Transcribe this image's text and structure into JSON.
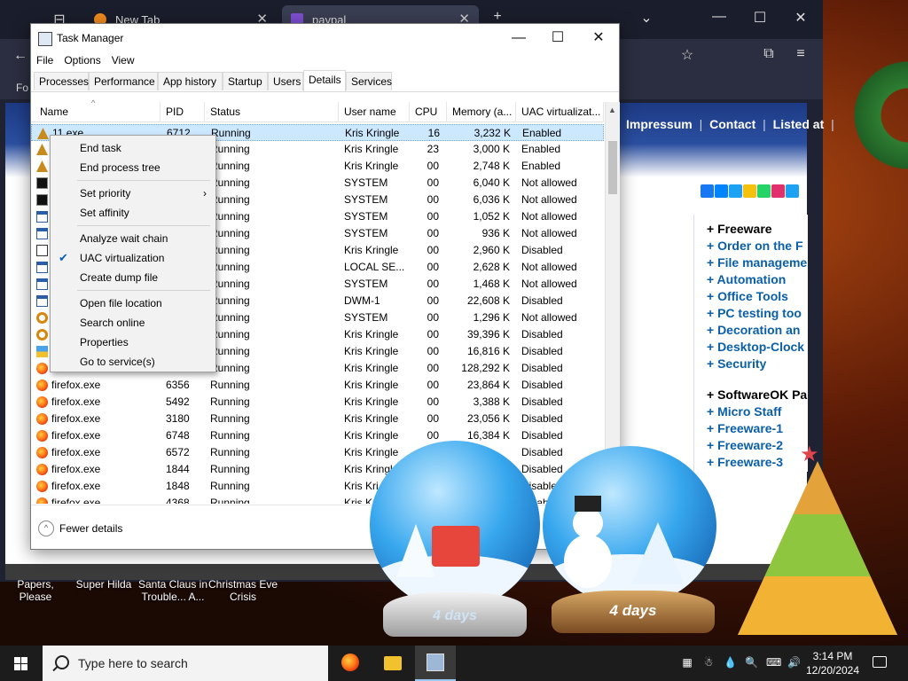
{
  "browser": {
    "tabs": [
      {
        "label": "New Tab",
        "close": "✕"
      },
      {
        "label": "paypal",
        "close": "✕"
      }
    ],
    "new_tab": "+",
    "list_tabs": "⌄",
    "win_min": "—",
    "win_max": "☐",
    "win_close": "✕",
    "bookmarks_start": "Fo",
    "site_nav": [
      "Impressum",
      "Contact",
      "Listed at"
    ],
    "site_nav_sep": "|",
    "sidebar_items": [
      {
        "label": "+ Freeware",
        "style": "black"
      },
      {
        "label": "+ Order on the F",
        "style": "blue"
      },
      {
        "label": "+ File manageme",
        "style": "blue"
      },
      {
        "label": "+ Automation",
        "style": "blue"
      },
      {
        "label": "+ Office Tools",
        "style": "blue"
      },
      {
        "label": "+ PC testing too",
        "style": "blue"
      },
      {
        "label": "+ Decoration an",
        "style": "blue"
      },
      {
        "label": "+ Desktop-Clock",
        "style": "blue"
      },
      {
        "label": "+ Security",
        "style": "blue"
      },
      {
        "label": "+ SoftwareOK Pa",
        "style": "black"
      },
      {
        "label": "+ Micro Staff",
        "style": "blue"
      },
      {
        "label": "+ Freeware-1",
        "style": "blue"
      },
      {
        "label": "+ Freeware-2",
        "style": "blue"
      },
      {
        "label": "+ Freeware-3",
        "style": "blue"
      }
    ],
    "social_colors": [
      "#1877f2",
      "#0084ff",
      "#1da1f2",
      "#f4c20d",
      "#25d366",
      "#e1306c",
      "#1da1f2"
    ]
  },
  "desktop_labels": [
    {
      "text": "Papers, Please"
    },
    {
      "text": "Super Hilda"
    },
    {
      "text": "Santa Claus in Trouble... A..."
    },
    {
      "text": "Christmas Eve Crisis"
    }
  ],
  "taskmanager": {
    "title": "Task Manager",
    "win_min": "—",
    "win_max": "☐",
    "win_close": "✕",
    "menu": [
      "File",
      "Options",
      "View"
    ],
    "tabs": [
      "Processes",
      "Performance",
      "App history",
      "Startup",
      "Users",
      "Details",
      "Services"
    ],
    "active_tab": "Details",
    "columns": [
      "Name",
      "PID",
      "Status",
      "User name",
      "CPU",
      "Memory (a...",
      "UAC virtualizat..."
    ],
    "sort_caret": "^",
    "rows": [
      {
        "icon": "tree",
        "name": "11.exe",
        "pid": "6712",
        "status": "Running",
        "user": "Kris Kringle",
        "cpu": "16",
        "mem": "3,232 K",
        "uac": "Enabled",
        "selected": true
      },
      {
        "icon": "tree",
        "name": "",
        "pid": "",
        "status": "Running",
        "user": "Kris Kringle",
        "cpu": "23",
        "mem": "3,000 K",
        "uac": "Enabled"
      },
      {
        "icon": "tree",
        "name": "",
        "pid": "",
        "status": "Running",
        "user": "Kris Kringle",
        "cpu": "00",
        "mem": "2,748 K",
        "uac": "Enabled"
      },
      {
        "icon": "cmd",
        "name": "",
        "pid": "",
        "status": "Running",
        "user": "SYSTEM",
        "cpu": "00",
        "mem": "6,040 K",
        "uac": "Not allowed"
      },
      {
        "icon": "cmd",
        "name": "",
        "pid": "",
        "status": "Running",
        "user": "SYSTEM",
        "cpu": "00",
        "mem": "6,036 K",
        "uac": "Not allowed"
      },
      {
        "icon": "win",
        "name": "",
        "pid": "",
        "status": "Running",
        "user": "SYSTEM",
        "cpu": "00",
        "mem": "1,052 K",
        "uac": "Not allowed"
      },
      {
        "icon": "win",
        "name": "",
        "pid": "",
        "status": "Running",
        "user": "SYSTEM",
        "cpu": "00",
        "mem": "936 K",
        "uac": "Not allowed"
      },
      {
        "icon": "pen",
        "name": "",
        "pid": "",
        "status": "Running",
        "user": "Kris Kringle",
        "cpu": "00",
        "mem": "2,960 K",
        "uac": "Disabled"
      },
      {
        "icon": "win",
        "name": "",
        "pid": "",
        "status": "Running",
        "user": "LOCAL SE...",
        "cpu": "00",
        "mem": "2,628 K",
        "uac": "Not allowed"
      },
      {
        "icon": "win",
        "name": "",
        "pid": "",
        "status": "Running",
        "user": "SYSTEM",
        "cpu": "00",
        "mem": "1,468 K",
        "uac": "Not allowed"
      },
      {
        "icon": "win",
        "name": "",
        "pid": "",
        "status": "Running",
        "user": "DWM-1",
        "cpu": "00",
        "mem": "22,608 K",
        "uac": "Disabled"
      },
      {
        "icon": "mag",
        "name": "",
        "pid": "",
        "status": "Running",
        "user": "SYSTEM",
        "cpu": "00",
        "mem": "1,296 K",
        "uac": "Not allowed"
      },
      {
        "icon": "mag",
        "name": "",
        "pid": "",
        "status": "Running",
        "user": "Kris Kringle",
        "cpu": "00",
        "mem": "39,396 K",
        "uac": "Disabled"
      },
      {
        "icon": "store",
        "name": "",
        "pid": "",
        "status": "Running",
        "user": "Kris Kringle",
        "cpu": "00",
        "mem": "16,816 K",
        "uac": "Disabled"
      },
      {
        "icon": "ff",
        "name": "",
        "pid": "",
        "status": "Running",
        "user": "Kris Kringle",
        "cpu": "00",
        "mem": "128,292 K",
        "uac": "Disabled"
      },
      {
        "icon": "ff",
        "name": "firefox.exe",
        "pid": "6356",
        "status": "Running",
        "user": "Kris Kringle",
        "cpu": "00",
        "mem": "23,864 K",
        "uac": "Disabled"
      },
      {
        "icon": "ff",
        "name": "firefox.exe",
        "pid": "5492",
        "status": "Running",
        "user": "Kris Kringle",
        "cpu": "00",
        "mem": "3,388 K",
        "uac": "Disabled"
      },
      {
        "icon": "ff",
        "name": "firefox.exe",
        "pid": "3180",
        "status": "Running",
        "user": "Kris Kringle",
        "cpu": "00",
        "mem": "23,056 K",
        "uac": "Disabled"
      },
      {
        "icon": "ff",
        "name": "firefox.exe",
        "pid": "6748",
        "status": "Running",
        "user": "Kris Kringle",
        "cpu": "00",
        "mem": "16,384 K",
        "uac": "Disabled"
      },
      {
        "icon": "ff",
        "name": "firefox.exe",
        "pid": "6572",
        "status": "Running",
        "user": "Kris Kringle",
        "cpu": "",
        "mem": "",
        "uac": "Disabled"
      },
      {
        "icon": "ff",
        "name": "firefox.exe",
        "pid": "1844",
        "status": "Running",
        "user": "Kris Kringle",
        "cpu": "",
        "mem": "",
        "uac": "Disabled"
      },
      {
        "icon": "ff",
        "name": "firefox.exe",
        "pid": "1848",
        "status": "Running",
        "user": "Kris Kri",
        "cpu": "",
        "mem": "",
        "uac": "Disable"
      },
      {
        "icon": "ff",
        "name": "firefox.exe",
        "pid": "4368",
        "status": "Running",
        "user": "Kris Kri",
        "cpu": "",
        "mem": "",
        "uac": "Disable"
      }
    ],
    "footer_toggle": "Fewer details",
    "footer_icon": "^"
  },
  "context_menu": {
    "items": [
      {
        "label": "End task",
        "type": "item"
      },
      {
        "label": "End process tree",
        "type": "item"
      },
      {
        "type": "separator"
      },
      {
        "label": "Set priority",
        "type": "submenu",
        "arrow": "›"
      },
      {
        "label": "Set affinity",
        "type": "item"
      },
      {
        "type": "separator"
      },
      {
        "label": "Analyze wait chain",
        "type": "item"
      },
      {
        "label": "UAC virtualization",
        "type": "checked",
        "check": "✔"
      },
      {
        "label": "Create dump file",
        "type": "item"
      },
      {
        "type": "separator"
      },
      {
        "label": "Open file location",
        "type": "item"
      },
      {
        "label": "Search online",
        "type": "item"
      },
      {
        "label": "Properties",
        "type": "item"
      },
      {
        "label": "Go to service(s)",
        "type": "item"
      }
    ]
  },
  "decorations": {
    "globe_left_label": "4 days",
    "globe_right_label": "4 days",
    "star": "★"
  },
  "taskbar": {
    "search_placeholder": "Type here to search",
    "apps": [
      {
        "name": "firefox",
        "color": "#ff7a1a"
      },
      {
        "name": "file-explorer",
        "color": "#f2c12e"
      },
      {
        "name": "task-manager",
        "color": "#9db8d6",
        "active": true
      }
    ],
    "tray": [
      "▦",
      "☃",
      "💧",
      "🔍",
      "⌨",
      "🔊"
    ],
    "time": "3:14 PM",
    "date": "12/20/2024"
  }
}
